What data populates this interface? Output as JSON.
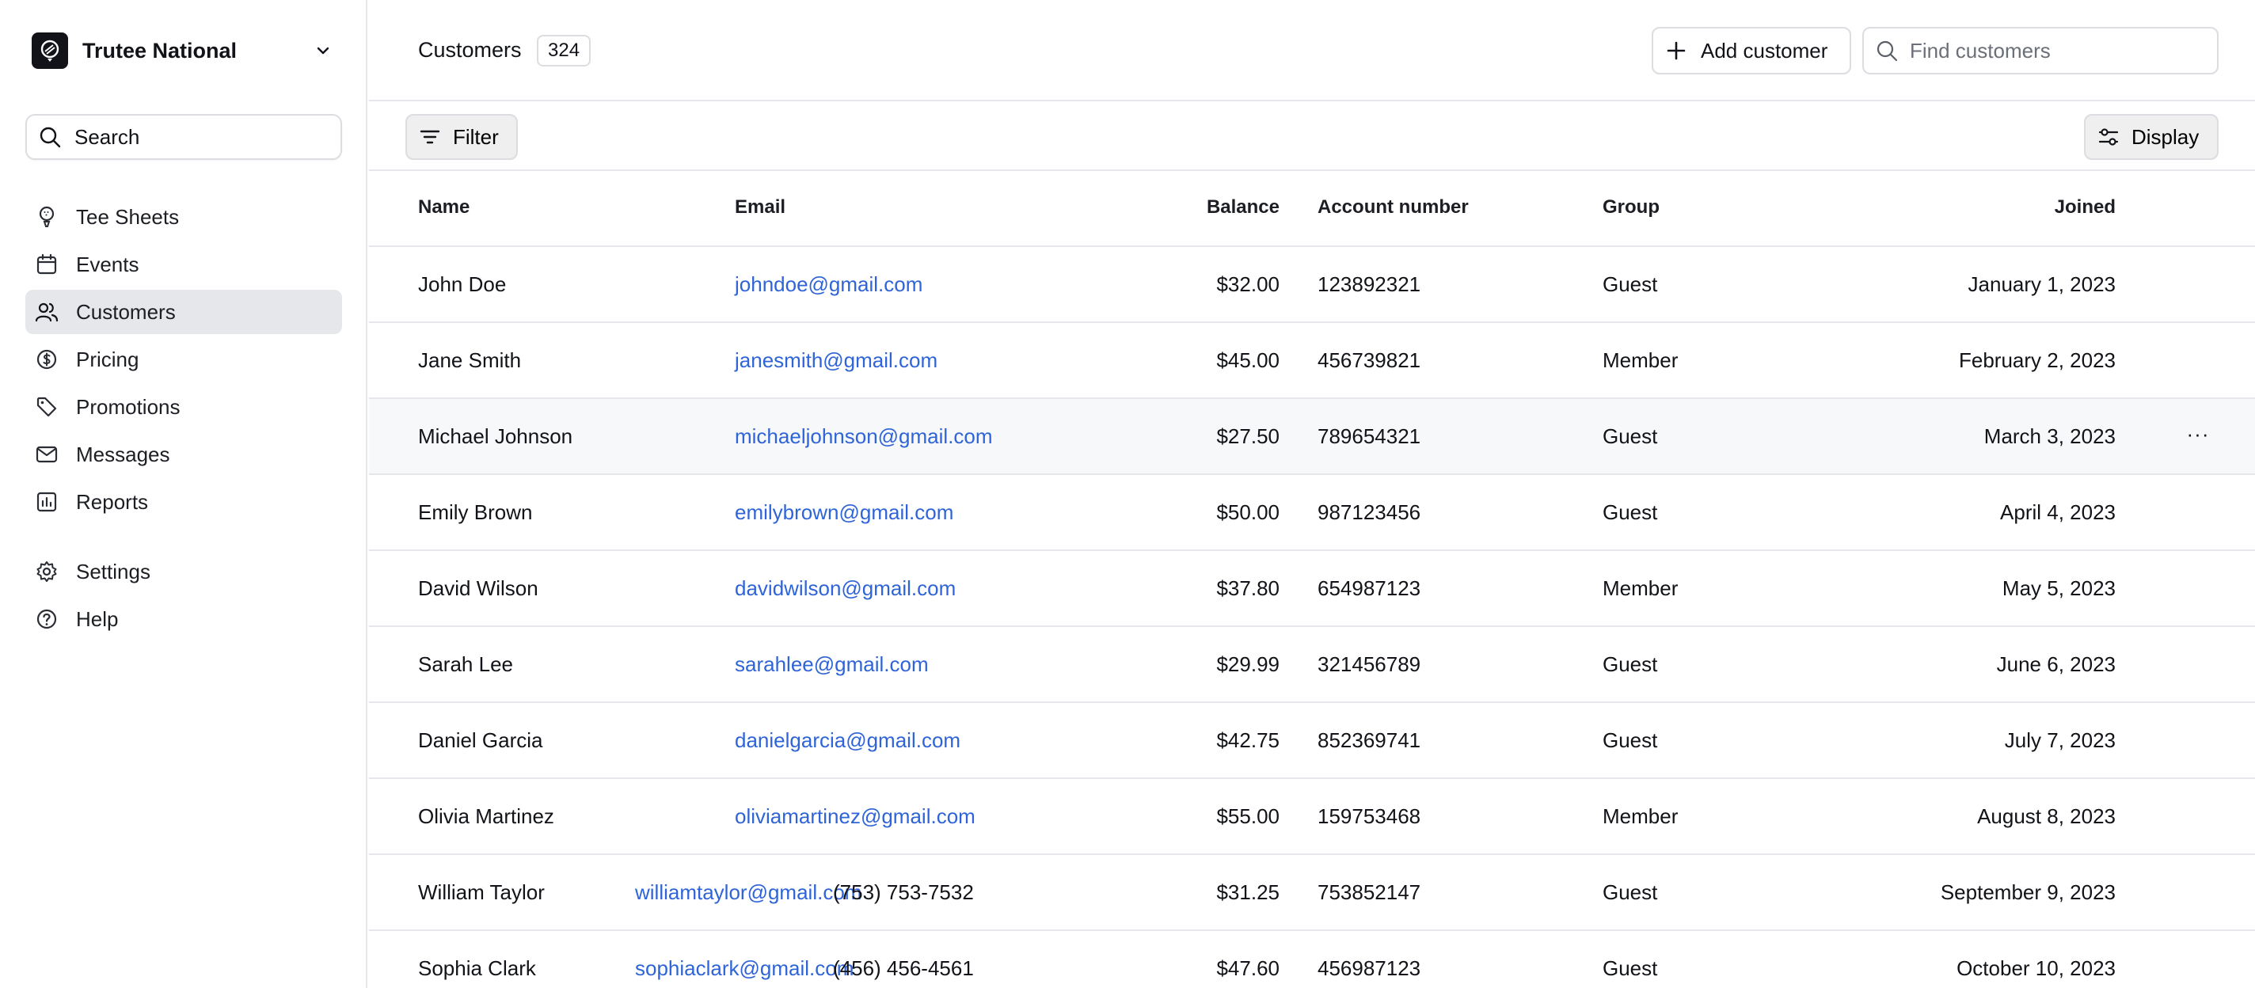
{
  "org": {
    "name": "Trutee National"
  },
  "sidebar": {
    "search_label": "Search",
    "items": [
      {
        "label": "Tee Sheets",
        "icon": "golf-ball-tee-icon",
        "active": false
      },
      {
        "label": "Events",
        "icon": "calendar-icon",
        "active": false
      },
      {
        "label": "Customers",
        "icon": "users-icon",
        "active": true
      },
      {
        "label": "Pricing",
        "icon": "dollar-circle-icon",
        "active": false
      },
      {
        "label": "Promotions",
        "icon": "tag-icon",
        "active": false
      },
      {
        "label": "Messages",
        "icon": "mail-icon",
        "active": false
      },
      {
        "label": "Reports",
        "icon": "bar-chart-icon",
        "active": false
      }
    ],
    "footer_items": [
      {
        "label": "Settings",
        "icon": "gear-icon"
      },
      {
        "label": "Help",
        "icon": "help-circle-icon"
      }
    ]
  },
  "header": {
    "title": "Customers",
    "count": "324",
    "add_label": "Add customer",
    "find_placeholder": "Find customers"
  },
  "toolbar": {
    "filter_label": "Filter",
    "display_label": "Display"
  },
  "table": {
    "columns": [
      "Name",
      "Email",
      "Balance",
      "Account number",
      "Group",
      "Joined"
    ],
    "rows": [
      {
        "name": "John Doe",
        "email": "johndoe@gmail.com",
        "phone": "",
        "balance": "$32.00",
        "account": "123892321",
        "group": "Guest",
        "joined": "January 1, 2023"
      },
      {
        "name": "Jane Smith",
        "email": "janesmith@gmail.com",
        "phone": "",
        "balance": "$45.00",
        "account": "456739821",
        "group": "Member",
        "joined": "February 2, 2023"
      },
      {
        "name": "Michael Johnson",
        "email": "michaeljohnson@gmail.com",
        "phone": "",
        "balance": "$27.50",
        "account": "789654321",
        "group": "Guest",
        "joined": "March 3, 2023"
      },
      {
        "name": "Emily Brown",
        "email": "emilybrown@gmail.com",
        "phone": "",
        "balance": "$50.00",
        "account": "987123456",
        "group": "Guest",
        "joined": "April 4, 2023"
      },
      {
        "name": "David Wilson",
        "email": "davidwilson@gmail.com",
        "phone": "",
        "balance": "$37.80",
        "account": "654987123",
        "group": "Member",
        "joined": "May 5, 2023"
      },
      {
        "name": "Sarah Lee",
        "email": "sarahlee@gmail.com",
        "phone": "",
        "balance": "$29.99",
        "account": "321456789",
        "group": "Guest",
        "joined": "June 6, 2023"
      },
      {
        "name": "Daniel Garcia",
        "email": "danielgarcia@gmail.com",
        "phone": "",
        "balance": "$42.75",
        "account": "852369741",
        "group": "Guest",
        "joined": "July 7, 2023"
      },
      {
        "name": "Olivia Martinez",
        "email": "oliviamartinez@gmail.com",
        "phone": "",
        "balance": "$55.00",
        "account": "159753468",
        "group": "Member",
        "joined": "August 8, 2023"
      },
      {
        "name": "William Taylor",
        "email": "williamtaylor@gmail.com",
        "phone": "(753) 753-7532",
        "balance": "$31.25",
        "account": "753852147",
        "group": "Guest",
        "joined": "September 9, 2023"
      },
      {
        "name": "Sophia Clark",
        "email": "sophiaclark@gmail.com",
        "phone": "(456) 456-4561",
        "balance": "$47.60",
        "account": "456987123",
        "group": "Guest",
        "joined": "October 10, 2023"
      }
    ],
    "row_menu": "···"
  },
  "colors": {
    "link": "#2f64d8",
    "border": "#e6e7ea",
    "active_bg": "#e6e7ea",
    "hover_bg": "#f7f8f9"
  }
}
